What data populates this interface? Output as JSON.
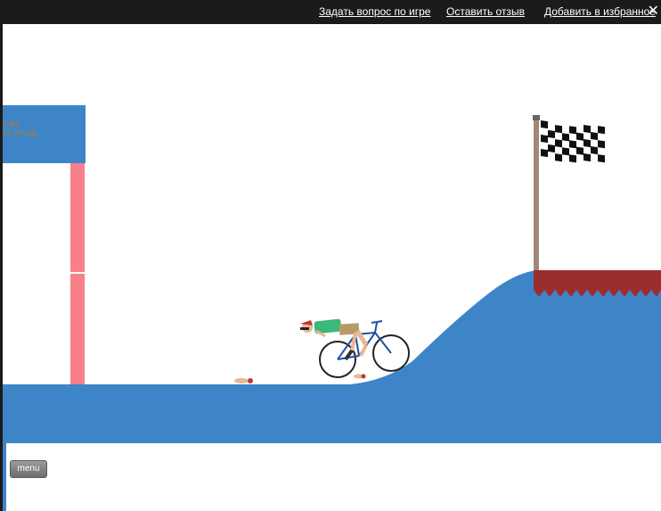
{
  "topbar": {
    "links": {
      "ask": "Задать вопрос по игре",
      "review": "Оставить отзыв",
      "favorite": "Добавить в избранное"
    },
    "close_label": "✕"
  },
  "game": {
    "debug": {
      "fps": "0 fps",
      "memory": "15.70 MB"
    },
    "menu_label": "menu",
    "colors": {
      "ground": "#3d85c6",
      "pillar": "#f88088",
      "platform": "#9b2d30",
      "background": "#ffffff",
      "flag_pole": "#a08878"
    }
  }
}
